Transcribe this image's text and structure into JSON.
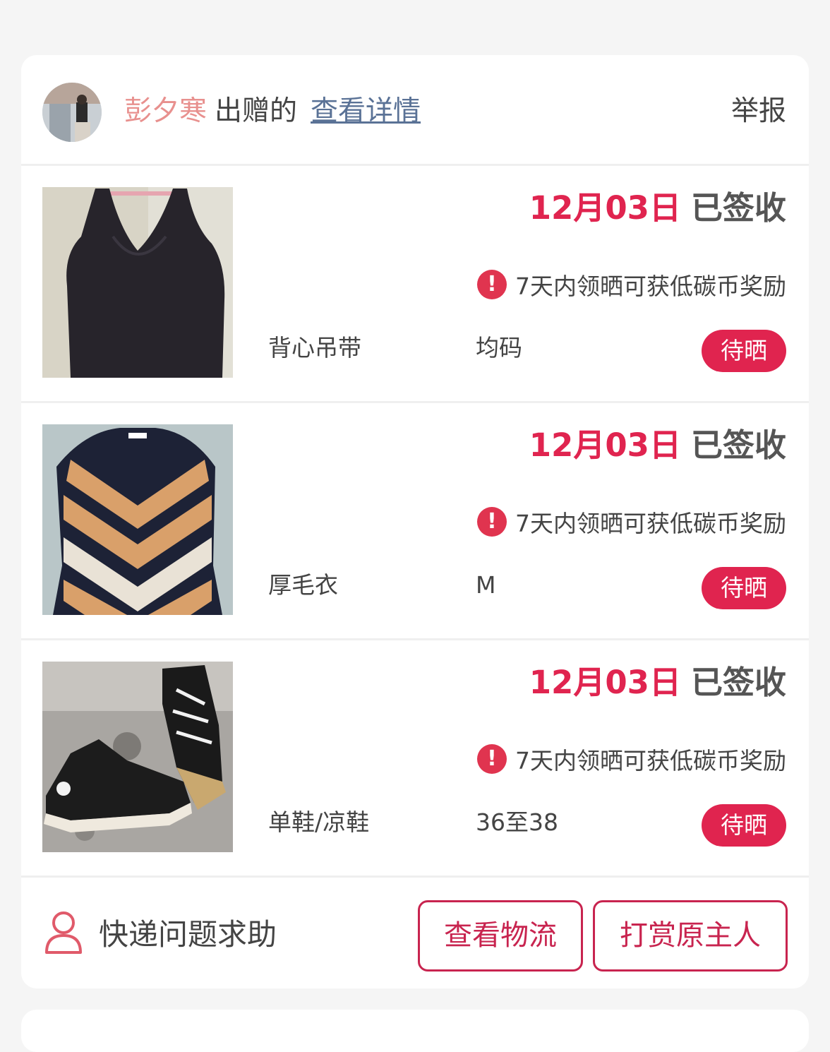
{
  "header": {
    "donor_name": "彭夕寒",
    "donated_label": "出赠的",
    "details_link": "查看详情",
    "report_label": "举报"
  },
  "items": [
    {
      "image": "black-camisole-photo",
      "date": "12月03日",
      "status": "已签收",
      "notice": "7天内领晒可获低碳币奖励",
      "name": "背心吊带",
      "size": "均码",
      "badge": "待晒"
    },
    {
      "image": "striped-sweater-photo",
      "date": "12月03日",
      "status": "已签收",
      "notice": "7天内领晒可获低碳币奖励",
      "name": "厚毛衣",
      "size": "M",
      "badge": "待晒"
    },
    {
      "image": "black-sneakers-photo",
      "date": "12月03日",
      "status": "已签收",
      "notice": "7天内领晒可获低碳币奖励",
      "name": "单鞋/凉鞋",
      "size": "36至38",
      "badge": "待晒"
    }
  ],
  "footer": {
    "help_label": "快递问题求助",
    "logistics_button": "查看物流",
    "tip_button": "打赏原主人"
  },
  "colors": {
    "accent": "#e0244f",
    "donor": "#e8908e",
    "link": "#5a7296"
  }
}
